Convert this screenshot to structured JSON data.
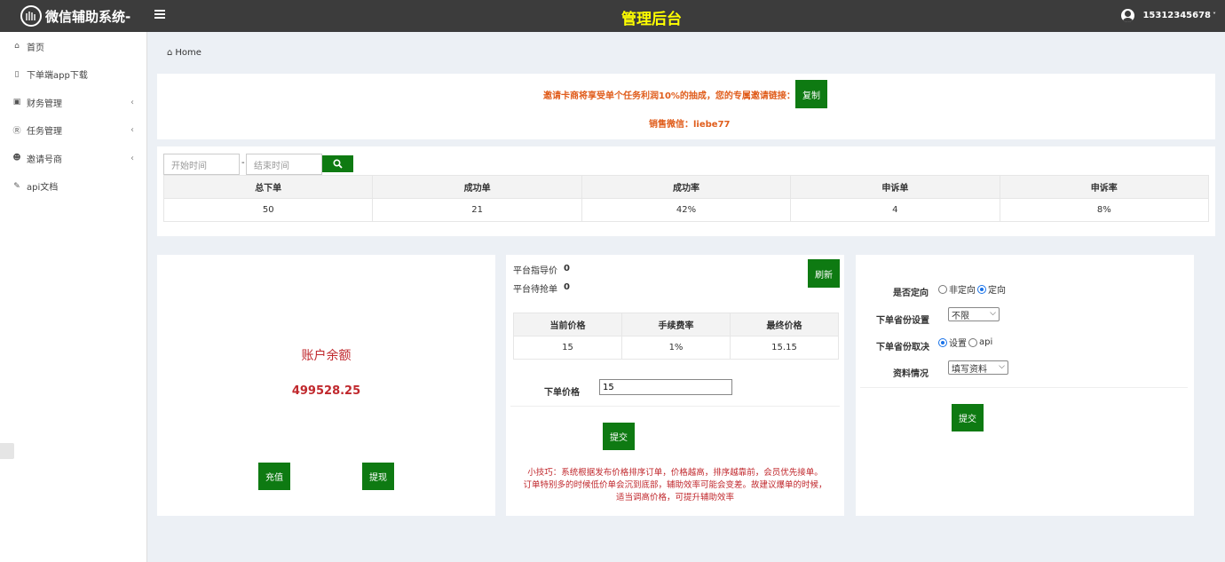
{
  "header": {
    "brand": "微信辅助系统-",
    "center_title": "管理后台",
    "user": "15312345678"
  },
  "sidebar": {
    "items": [
      {
        "label": "首页",
        "icon": "home-icon"
      },
      {
        "label": "下单端app下载",
        "icon": "mobile-icon"
      },
      {
        "label": "财务管理",
        "icon": "money-icon"
      },
      {
        "label": "任务管理",
        "icon": "registered-icon"
      },
      {
        "label": "邀请号商",
        "icon": "users-icon"
      },
      {
        "label": "api文档",
        "icon": "pencil-icon"
      }
    ]
  },
  "breadcrumb": {
    "label": "Home"
  },
  "notice": {
    "text": "邀请卡商将享受单个任务利润10%的抽成，您的专属邀请链接：",
    "copy_label": "复制",
    "sales": "销售微信：liebe77"
  },
  "filter": {
    "start_placeholder": "开始时间",
    "separator": "-",
    "end_placeholder": "结束时间"
  },
  "stats": {
    "headers": [
      "总下单",
      "成功单",
      "成功率",
      "申诉单",
      "申诉率"
    ],
    "values": [
      "50",
      "21",
      "42%",
      "4",
      "8%"
    ]
  },
  "balance": {
    "title": "账户余额",
    "amount": "499528.25",
    "recharge_label": "充值",
    "withdraw_label": "提现"
  },
  "pricing": {
    "guide_label": "平台指导价",
    "guide_value": "0",
    "pending_label": "平台待抢单",
    "pending_value": "0",
    "refresh_label": "刷新",
    "headers": [
      "当前价格",
      "手续费率",
      "最终价格"
    ],
    "values": [
      "15",
      "1%",
      "15.15"
    ],
    "order_price_label": "下单价格",
    "order_price_value": "15",
    "submit_label": "提交",
    "tip": "小技巧：系统根据发布价格排序订单，价格越高，排序越靠前，会员优先接单。订单特别多的时候低价单会沉到底部，辅助效率可能会变差。故建议爆单的时候，适当调高价格，可提升辅助效率",
    "tip_line1": "小技巧：系统根据发布价格排序订单，价格越高，排序越靠前，会员优先接单。",
    "tip_line2": "订单特别多的时候低价单会沉到底部，辅助效率可能会变差。故建议爆单的时候，",
    "tip_line3": "适当调高价格，可提升辅助效率"
  },
  "settings": {
    "directed_label": "是否定向",
    "option_undirected": "非定向",
    "option_directed": "定向",
    "province_label": "下单省份设置",
    "province_value": "不限",
    "source_label": "下单省份取决",
    "option_setting": "设置",
    "option_api": "api",
    "info_label": "资料情况",
    "info_value": "填写资料",
    "submit_label": "提交"
  },
  "colors": {
    "header_bg": "#3c3c3c",
    "title_yellow": "#ffff00",
    "button_green": "#0e7a12",
    "balance_red": "#c0282d",
    "notice_orange": "#e05d1c"
  }
}
